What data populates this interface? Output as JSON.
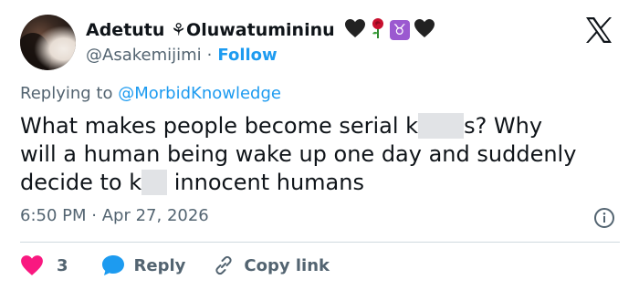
{
  "author": {
    "display_name": "Adetutu ⚘Oluwatumininu",
    "handle": "@Asakemijimi",
    "separator": "·",
    "follow_label": "Follow",
    "emojis": [
      "black-heart",
      "rose",
      "taurus",
      "black-heart"
    ],
    "taurus_glyph": "♉"
  },
  "reply_context": {
    "prefix": "Replying to",
    "mention": "@MorbidKnowledge"
  },
  "tweet": {
    "line1_a": "What makes people become serial k",
    "line1_b": "s? Why",
    "line2": "will a human being wake up one day and suddenly",
    "line3_a": "decide to k",
    "line3_b": " innocent humans"
  },
  "meta": {
    "time": "6:50 PM",
    "separator": "·",
    "date": "Apr 27, 2026"
  },
  "actions": {
    "like_count": "3",
    "reply_label": "Reply",
    "copy_label": "Copy link"
  },
  "colors": {
    "accent": "#1d9bf0",
    "like": "#f91880",
    "text": "#0f1419",
    "muted": "#536471",
    "divider": "#cfd9de",
    "redacted": "#e1e3e6"
  },
  "icons": {
    "platform": "x-logo-icon",
    "info": "info-icon",
    "like": "heart-icon",
    "reply": "reply-bubble-icon",
    "copy": "link-icon"
  }
}
